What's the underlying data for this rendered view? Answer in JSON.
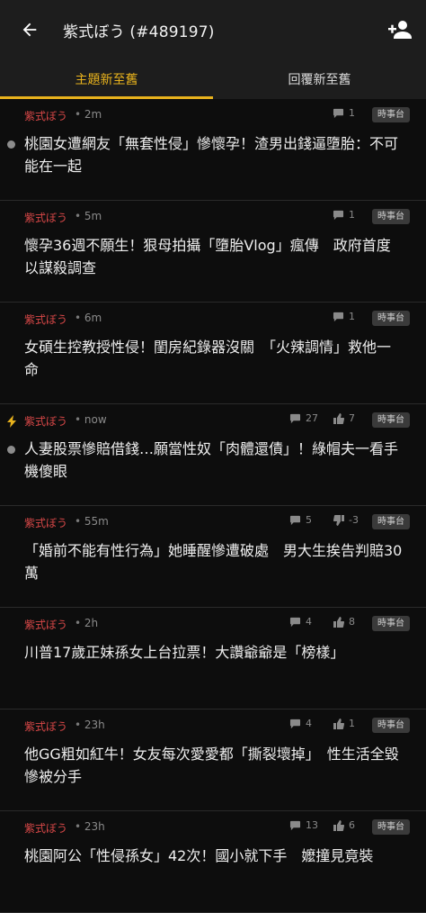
{
  "header": {
    "title": "紫式ぼう (#489197)"
  },
  "tabs": [
    {
      "label": "主題新至舊",
      "active": true
    },
    {
      "label": "回覆新至舊",
      "active": false
    }
  ],
  "posts": [
    {
      "author": "紫式ぼう",
      "time": "2m",
      "comments": "1",
      "votes": "",
      "tag": "時事台",
      "body": "桃園女遭網友「無套性侵」慘懷孕！渣男出錢逼墮胎：不可能在一起",
      "unread": true,
      "hot": false
    },
    {
      "author": "紫式ぼう",
      "time": "5m",
      "comments": "1",
      "votes": "",
      "tag": "時事台",
      "body": "懷孕36週不願生！狠母拍攝「墮胎Vlog」瘋傳　政府首度以謀殺調查",
      "unread": false,
      "hot": false
    },
    {
      "author": "紫式ぼう",
      "time": "6m",
      "comments": "1",
      "votes": "",
      "tag": "時事台",
      "body": "女碩生控教授性侵！閨房紀錄器沒關　「火辣調情」救他一命",
      "unread": false,
      "hot": false
    },
    {
      "author": "紫式ぼう",
      "time": "now",
      "comments": "27",
      "votes": "7",
      "tag": "時事台",
      "body": "人妻股票慘賠借錢…願當性奴「肉體還債」！綠帽夫一看手機傻眼",
      "unread": true,
      "hot": true,
      "vote_dir": "up"
    },
    {
      "author": "紫式ぼう",
      "time": "55m",
      "comments": "5",
      "votes": "-3",
      "tag": "時事台",
      "body": "「婚前不能有性行為」她睡醒慘遭破處　男大生挨告判賠30萬",
      "unread": false,
      "hot": false,
      "vote_dir": "down"
    },
    {
      "author": "紫式ぼう",
      "time": "2h",
      "comments": "4",
      "votes": "8",
      "tag": "時事台",
      "body": "川普17歲正妹孫女上台拉票！大讚爺爺是「榜樣」",
      "unread": false,
      "hot": false,
      "vote_dir": "up"
    },
    {
      "author": "紫式ぼう",
      "time": "23h",
      "comments": "4",
      "votes": "1",
      "tag": "時事台",
      "body": "他GG粗如紅牛！女友每次愛愛都「撕裂壞掉」　性生活全毀慘被分手",
      "unread": false,
      "hot": false,
      "vote_dir": "up"
    },
    {
      "author": "紫式ぼう",
      "time": "23h",
      "comments": "13",
      "votes": "6",
      "tag": "時事台",
      "body": "桃園阿公「性侵孫女」42次！國小就下手　嬤撞見竟裝",
      "unread": false,
      "hot": false,
      "vote_dir": "up"
    }
  ],
  "colors": {
    "accent": "#e8b21d",
    "author": "#d94848",
    "background": "#0d0d0d",
    "header": "#1d1d1d"
  }
}
